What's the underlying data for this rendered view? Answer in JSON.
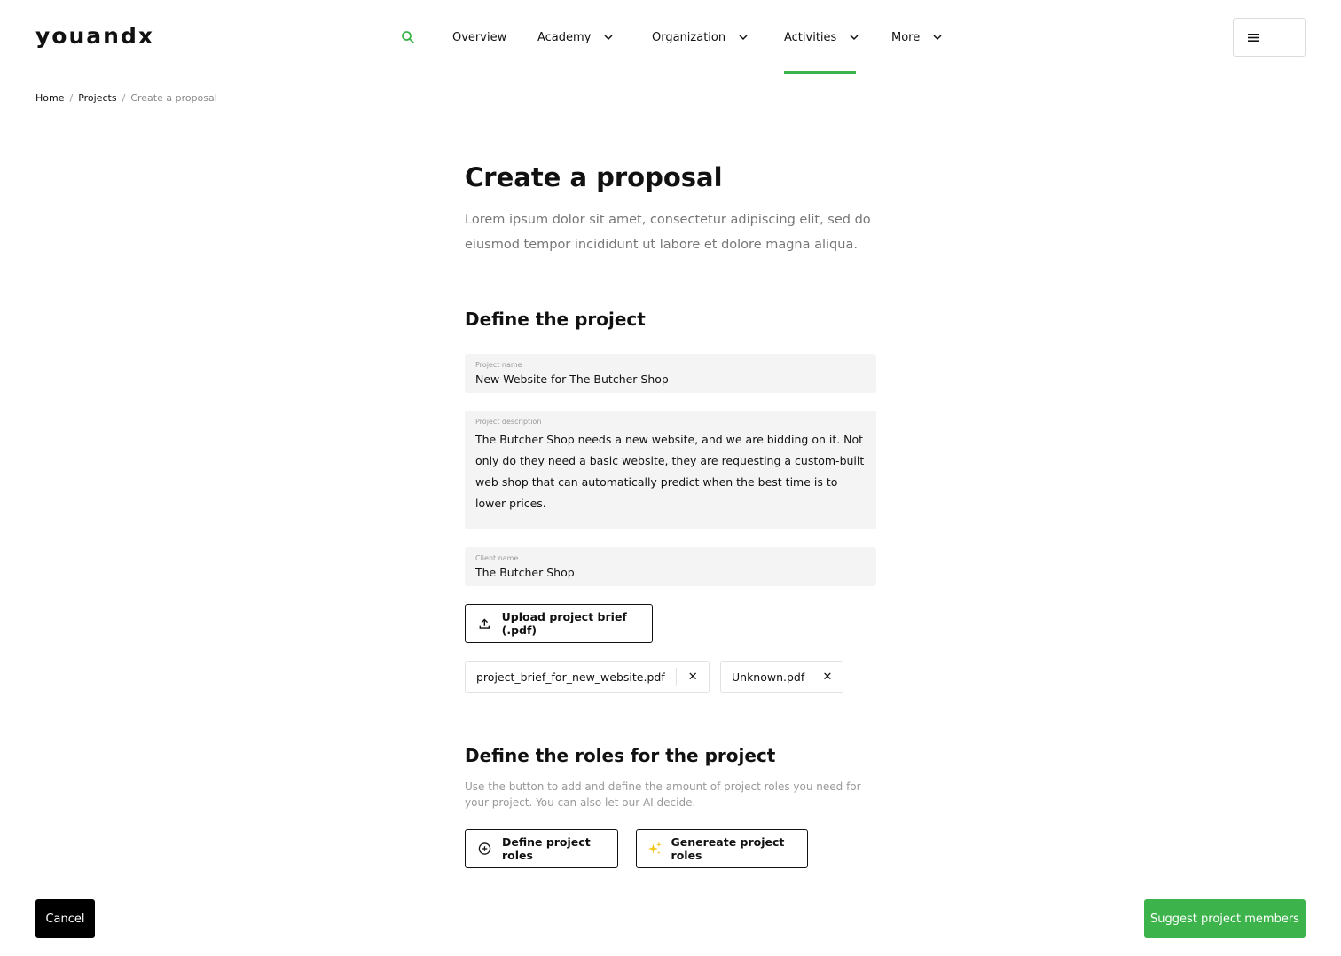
{
  "brand": {
    "logo": "youandx",
    "accent_color": "#3cb44b"
  },
  "nav": {
    "search_icon": "search-icon",
    "items": [
      {
        "label": "Overview",
        "has_dropdown": false,
        "active": false
      },
      {
        "label": "Academy",
        "has_dropdown": true,
        "active": false
      },
      {
        "label": "Organization",
        "has_dropdown": true,
        "active": false
      },
      {
        "label": "Activities",
        "has_dropdown": true,
        "active": true
      },
      {
        "label": "More",
        "has_dropdown": true,
        "active": false
      }
    ],
    "menu_icon": "hamburger-menu-icon"
  },
  "breadcrumb": {
    "items": [
      "Home",
      "Projects"
    ],
    "separator": "/",
    "current": "Create a proposal"
  },
  "page": {
    "title": "Create a proposal",
    "description": "Lorem ipsum dolor sit amet, consectetur adipiscing elit, sed do eiusmod tempor incididunt ut labore et dolore magna aliqua."
  },
  "define_project": {
    "title": "Define the project",
    "project_name": {
      "label": "Project name",
      "value": "New Website for The Butcher Shop"
    },
    "project_description": {
      "label": "Project description",
      "value": "The Butcher Shop needs a new website, and we are bidding on it. Not only do they need a basic website, they are requesting a custom-built web shop that can automatically predict when the best time is to lower prices."
    },
    "client_name": {
      "label": "Client name",
      "value": "The Butcher Shop"
    },
    "upload_button": "Upload project brief (.pdf)",
    "files": [
      {
        "name": "project_brief_for_new_website.pdf",
        "remove": "✕"
      },
      {
        "name": "Unknown.pdf",
        "remove": "✕"
      }
    ]
  },
  "define_roles": {
    "title": "Define the roles for the project",
    "description": "Use the button to add and define the amount of project roles you need for your project. You can also let our AI decide.",
    "define_button": "Define project roles",
    "generate_button": "Genereate project roles"
  },
  "footer": {
    "cancel": "Cancel",
    "suggest": "Suggest project members"
  }
}
